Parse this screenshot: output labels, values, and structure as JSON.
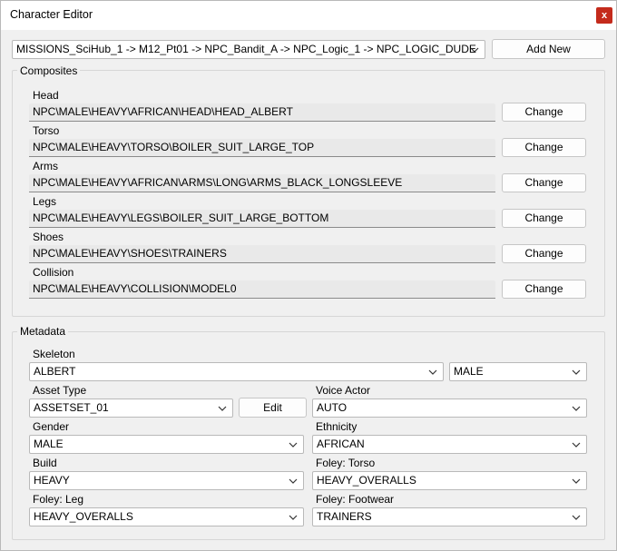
{
  "window": {
    "title": "Character Editor",
    "close_label": "x"
  },
  "path_select": {
    "value": "MISSIONS_SciHub_1 -> M12_Pt01 -> NPC_Bandit_A -> NPC_Logic_1 -> NPC_LOGIC_DUDE"
  },
  "add_new_label": "Add New",
  "composites": {
    "title": "Composites",
    "change_label": "Change",
    "items": [
      {
        "label": "Head",
        "value": "NPC\\MALE\\HEAVY\\AFRICAN\\HEAD\\HEAD_ALBERT"
      },
      {
        "label": "Torso",
        "value": "NPC\\MALE\\HEAVY\\TORSO\\BOILER_SUIT_LARGE_TOP"
      },
      {
        "label": "Arms",
        "value": "NPC\\MALE\\HEAVY\\AFRICAN\\ARMS\\LONG\\ARMS_BLACK_LONGSLEEVE"
      },
      {
        "label": "Legs",
        "value": "NPC\\MALE\\HEAVY\\LEGS\\BOILER_SUIT_LARGE_BOTTOM"
      },
      {
        "label": "Shoes",
        "value": "NPC\\MALE\\HEAVY\\SHOES\\TRAINERS"
      },
      {
        "label": "Collision",
        "value": "NPC\\MALE\\HEAVY\\COLLISION\\MODEL0"
      }
    ]
  },
  "metadata": {
    "title": "Metadata",
    "skeleton": {
      "label": "Skeleton",
      "value": "ALBERT",
      "sex_value": "MALE"
    },
    "asset_type": {
      "label": "Asset Type",
      "value": "ASSETSET_01",
      "edit_label": "Edit"
    },
    "voice_actor": {
      "label": "Voice Actor",
      "value": "AUTO"
    },
    "gender": {
      "label": "Gender",
      "value": "MALE"
    },
    "ethnicity": {
      "label": "Ethnicity",
      "value": "AFRICAN"
    },
    "build": {
      "label": "Build",
      "value": "HEAVY"
    },
    "foley_torso": {
      "label": "Foley: Torso",
      "value": "HEAVY_OVERALLS"
    },
    "foley_leg": {
      "label": "Foley: Leg",
      "value": "HEAVY_OVERALLS"
    },
    "foley_footwear": {
      "label": "Foley: Footwear",
      "value": "TRAINERS"
    }
  },
  "icons": {
    "close": "close-icon",
    "dropdown": "chevron-down-icon"
  },
  "colors": {
    "close_button": "#c42b1c",
    "window_bg": "#f0f0f0",
    "readonly_bg": "#e9e9e9"
  }
}
